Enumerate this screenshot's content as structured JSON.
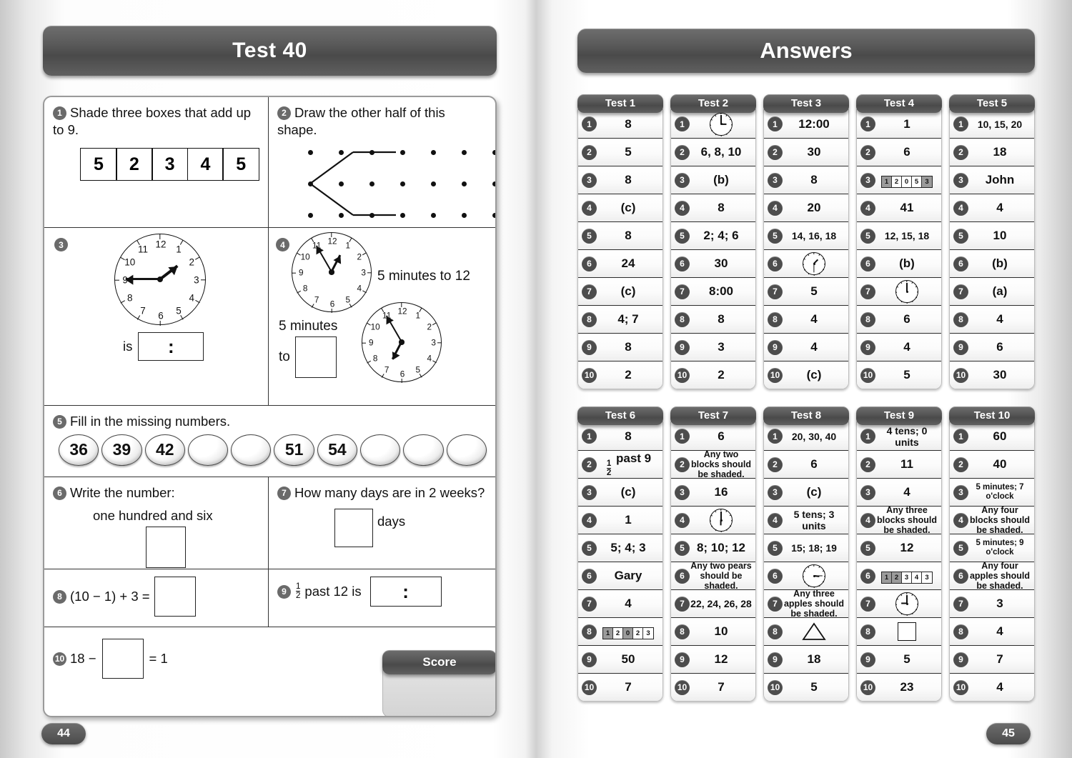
{
  "left_page": {
    "title": "Test 40",
    "page_number": "44",
    "score_label": "Score",
    "questions": [
      {
        "num": "1",
        "text": "Shade three boxes that add up to 9.",
        "boxes": [
          "5",
          "2",
          "3",
          "4",
          "5"
        ]
      },
      {
        "num": "2",
        "text": "Draw the other half of this shape.",
        "grid_cols": 7,
        "grid_rows": 3
      },
      {
        "num": "3",
        "text": "is",
        "clock": {
          "hour": 1,
          "minute": 45
        }
      },
      {
        "num": "4",
        "label_a": "5 minutes to 12",
        "label_b": "5 minutes",
        "label_b2": "to",
        "clock_a": {
          "hour": 12,
          "minute": 55
        },
        "clock_b": {
          "hour": 6,
          "minute": 55
        }
      },
      {
        "num": "5",
        "text": "Fill in the missing numbers.",
        "balls": [
          "36",
          "39",
          "42",
          "",
          "",
          "51",
          "54",
          "",
          "",
          ""
        ]
      },
      {
        "num": "6",
        "text": "Write the number:",
        "subtext": "one hundred and six"
      },
      {
        "num": "7",
        "text": "How many days are in 2 weeks?",
        "unit": "days"
      },
      {
        "num": "8",
        "text": "(10 − 1) + 3 ="
      },
      {
        "num": "9",
        "text_pre": "past 12 is",
        "fraction_top": "1",
        "fraction_bottom": "2"
      },
      {
        "num": "10",
        "text_pre": "18 −",
        "text_post": "= 1"
      }
    ]
  },
  "right_page": {
    "title": "Answers",
    "page_number": "45",
    "tests": [
      {
        "name": "Test 1",
        "answers": [
          {
            "n": "1",
            "v": "8"
          },
          {
            "n": "2",
            "v": "5"
          },
          {
            "n": "3",
            "v": "8"
          },
          {
            "n": "4",
            "v": "(c)"
          },
          {
            "n": "5",
            "v": "8"
          },
          {
            "n": "6",
            "v": "24"
          },
          {
            "n": "7",
            "v": "(c)"
          },
          {
            "n": "8",
            "v": "4; 7"
          },
          {
            "n": "9",
            "v": "8"
          },
          {
            "n": "10",
            "v": "2"
          }
        ]
      },
      {
        "name": "Test 2",
        "answers": [
          {
            "n": "1",
            "v": "",
            "type": "clock",
            "hour": 3,
            "minute": 0
          },
          {
            "n": "2",
            "v": "6, 8, 10"
          },
          {
            "n": "3",
            "v": "(b)"
          },
          {
            "n": "4",
            "v": "8"
          },
          {
            "n": "5",
            "v": "2; 4; 6"
          },
          {
            "n": "6",
            "v": "30"
          },
          {
            "n": "7",
            "v": "8:00"
          },
          {
            "n": "8",
            "v": "8"
          },
          {
            "n": "9",
            "v": "3"
          },
          {
            "n": "10",
            "v": "2"
          }
        ]
      },
      {
        "name": "Test 3",
        "answers": [
          {
            "n": "1",
            "v": "12:00"
          },
          {
            "n": "2",
            "v": "30"
          },
          {
            "n": "3",
            "v": "8"
          },
          {
            "n": "4",
            "v": "20"
          },
          {
            "n": "5",
            "v": "14, 16, 18",
            "size": "med"
          },
          {
            "n": "6",
            "v": "",
            "type": "clock",
            "hour": 1,
            "minute": 30
          },
          {
            "n": "7",
            "v": "5"
          },
          {
            "n": "8",
            "v": "4"
          },
          {
            "n": "9",
            "v": "4"
          },
          {
            "n": "10",
            "v": "(c)"
          }
        ]
      },
      {
        "name": "Test 4",
        "answers": [
          {
            "n": "1",
            "v": "1"
          },
          {
            "n": "2",
            "v": "6"
          },
          {
            "n": "3",
            "v": "",
            "type": "pvstrip",
            "digits": [
              "1",
              "2",
              "0",
              "5",
              "3"
            ],
            "shaded": [
              0,
              4
            ]
          },
          {
            "n": "4",
            "v": "41"
          },
          {
            "n": "5",
            "v": "12, 15, 18",
            "size": "med"
          },
          {
            "n": "6",
            "v": "(b)"
          },
          {
            "n": "7",
            "v": "",
            "type": "clock",
            "hour": 12,
            "minute": 0
          },
          {
            "n": "8",
            "v": "6"
          },
          {
            "n": "9",
            "v": "4"
          },
          {
            "n": "10",
            "v": "5"
          }
        ]
      },
      {
        "name": "Test 5",
        "answers": [
          {
            "n": "1",
            "v": "10, 15, 20",
            "size": "med"
          },
          {
            "n": "2",
            "v": "18"
          },
          {
            "n": "3",
            "v": "John"
          },
          {
            "n": "4",
            "v": "4"
          },
          {
            "n": "5",
            "v": "10"
          },
          {
            "n": "6",
            "v": "(b)"
          },
          {
            "n": "7",
            "v": "(a)"
          },
          {
            "n": "8",
            "v": "4"
          },
          {
            "n": "9",
            "v": "6"
          },
          {
            "n": "10",
            "v": "30"
          }
        ]
      },
      {
        "name": "Test 6",
        "answers": [
          {
            "n": "1",
            "v": "8"
          },
          {
            "n": "2",
            "v": "past 9",
            "type": "fraction",
            "top": "1",
            "bottom": "2"
          },
          {
            "n": "3",
            "v": "(c)"
          },
          {
            "n": "4",
            "v": "1"
          },
          {
            "n": "5",
            "v": "5; 4; 3"
          },
          {
            "n": "6",
            "v": "Gary"
          },
          {
            "n": "7",
            "v": "4"
          },
          {
            "n": "8",
            "v": "",
            "type": "pvstrip",
            "digits": [
              "1",
              "2",
              "0",
              "2",
              "3"
            ],
            "shaded": [
              0,
              2
            ]
          },
          {
            "n": "9",
            "v": "50"
          },
          {
            "n": "10",
            "v": "7"
          }
        ]
      },
      {
        "name": "Test 7",
        "answers": [
          {
            "n": "1",
            "v": "6"
          },
          {
            "n": "2",
            "v": "Any two blocks should be shaded.",
            "size": "small"
          },
          {
            "n": "3",
            "v": "16"
          },
          {
            "n": "4",
            "v": "",
            "type": "clock",
            "hour": 6,
            "minute": 0
          },
          {
            "n": "5",
            "v": "8; 10; 12"
          },
          {
            "n": "6",
            "v": "Any two pears should be shaded.",
            "size": "small"
          },
          {
            "n": "7",
            "v": "22, 24, 26, 28",
            "size": "med"
          },
          {
            "n": "8",
            "v": "10"
          },
          {
            "n": "9",
            "v": "12"
          },
          {
            "n": "10",
            "v": "7"
          }
        ]
      },
      {
        "name": "Test 8",
        "answers": [
          {
            "n": "1",
            "v": "20, 30, 40",
            "size": "med"
          },
          {
            "n": "2",
            "v": "6"
          },
          {
            "n": "3",
            "v": "(c)"
          },
          {
            "n": "4",
            "v": "5 tens; 3 units",
            "size": "med"
          },
          {
            "n": "5",
            "v": "15; 18; 19",
            "size": "med"
          },
          {
            "n": "6",
            "v": "",
            "type": "clock",
            "hour": 3,
            "minute": 15
          },
          {
            "n": "7",
            "v": "Any three apples should be shaded.",
            "size": "small"
          },
          {
            "n": "8",
            "v": "",
            "type": "triangle"
          },
          {
            "n": "9",
            "v": "18"
          },
          {
            "n": "10",
            "v": "5"
          }
        ]
      },
      {
        "name": "Test 9",
        "answers": [
          {
            "n": "1",
            "v": "4 tens; 0 units",
            "size": "med"
          },
          {
            "n": "2",
            "v": "11"
          },
          {
            "n": "3",
            "v": "4"
          },
          {
            "n": "4",
            "v": "Any three blocks should be shaded.",
            "size": "small"
          },
          {
            "n": "5",
            "v": "12"
          },
          {
            "n": "6",
            "v": "",
            "type": "pvstrip",
            "digits": [
              "1",
              "2",
              "3",
              "4",
              "3"
            ],
            "shaded": [
              0,
              1
            ]
          },
          {
            "n": "7",
            "v": "",
            "type": "clock",
            "hour": 9,
            "minute": 0
          },
          {
            "n": "8",
            "v": "",
            "type": "square"
          },
          {
            "n": "9",
            "v": "5"
          },
          {
            "n": "10",
            "v": "23"
          }
        ]
      },
      {
        "name": "Test 10",
        "answers": [
          {
            "n": "1",
            "v": "60"
          },
          {
            "n": "2",
            "v": "40"
          },
          {
            "n": "3",
            "v": "5 minutes; 7 o'clock",
            "size": "tiny"
          },
          {
            "n": "4",
            "v": "Any four blocks should be shaded.",
            "size": "small"
          },
          {
            "n": "5",
            "v": "5 minutes; 9 o'clock",
            "size": "tiny"
          },
          {
            "n": "6",
            "v": "Any four apples should be shaded.",
            "size": "small"
          },
          {
            "n": "7",
            "v": "3"
          },
          {
            "n": "8",
            "v": "4"
          },
          {
            "n": "9",
            "v": "7"
          },
          {
            "n": "10",
            "v": "4"
          }
        ]
      }
    ]
  }
}
